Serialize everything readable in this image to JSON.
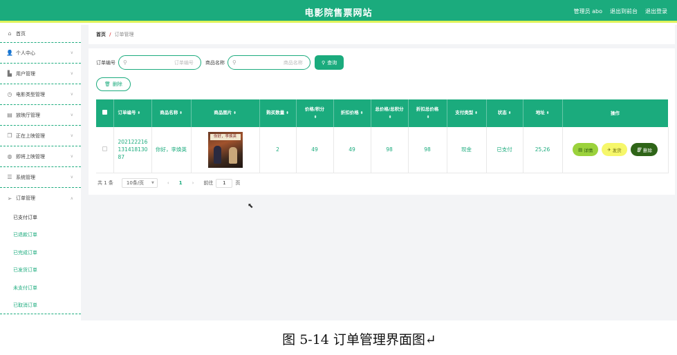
{
  "header": {
    "title": "电影院售票网站",
    "admin_label": "管理员 abo",
    "exit_backend": "退出到前台",
    "logout": "退出登录"
  },
  "sidebar": {
    "items": [
      {
        "label": "首页",
        "icon": "home-icon"
      },
      {
        "label": "个人中心",
        "icon": "user-icon"
      },
      {
        "label": "用户管理",
        "icon": "chart-icon"
      },
      {
        "label": "电影类型管理",
        "icon": "clock-icon"
      },
      {
        "label": "放映厅管理",
        "icon": "calendar-icon"
      },
      {
        "label": "正在上映管理",
        "icon": "copy-icon"
      },
      {
        "label": "即将上映管理",
        "icon": "compass-icon"
      },
      {
        "label": "系统管理",
        "icon": "sliders-icon"
      },
      {
        "label": "订单管理",
        "icon": "send-icon"
      }
    ],
    "sub_items": [
      "已支付订单",
      "已退款订单",
      "已完成订单",
      "已发货订单",
      "未支付订单",
      "已取消订单"
    ]
  },
  "breadcrumb": {
    "home": "首页",
    "separator": "/",
    "current": "订单管理"
  },
  "search": {
    "order_no_label": "订单编号",
    "order_no_placeholder": "订单编号",
    "product_label": "商品名称",
    "product_placeholder": "商品名称",
    "search_button": "查询"
  },
  "delete_button": "删除",
  "table": {
    "headers": [
      "订单编号",
      "商品名称",
      "商品图片",
      "购买数量",
      "价格/积分",
      "折扣价格",
      "总价格/总积分",
      "折扣总价格",
      "支付类型",
      "状态",
      "地址",
      "操作"
    ],
    "rows": [
      {
        "order_no": "20212221613141813087",
        "product": "你好，李焕英",
        "poster_text": "你好，李焕英",
        "quantity": "2",
        "price": "49",
        "discount_price": "49",
        "total": "98",
        "discount_total": "98",
        "pay_type": "现金",
        "status": "已支付",
        "address": "25,26",
        "actions": {
          "detail": "详情",
          "ship": "发货",
          "delete": "删除"
        }
      }
    ]
  },
  "pager": {
    "total": "共 1 条",
    "page_size": "10条/页",
    "current_page": "1",
    "goto_label": "前往",
    "goto_value": "1",
    "page_unit": "页"
  },
  "caption": "图 5-14 订单管理界面图↵",
  "colors": {
    "accent": "#1bab7d",
    "header_stripe": "#dff35a",
    "detail": "#9bd23c",
    "ship": "#f6f76a",
    "delete": "#2e6417"
  }
}
